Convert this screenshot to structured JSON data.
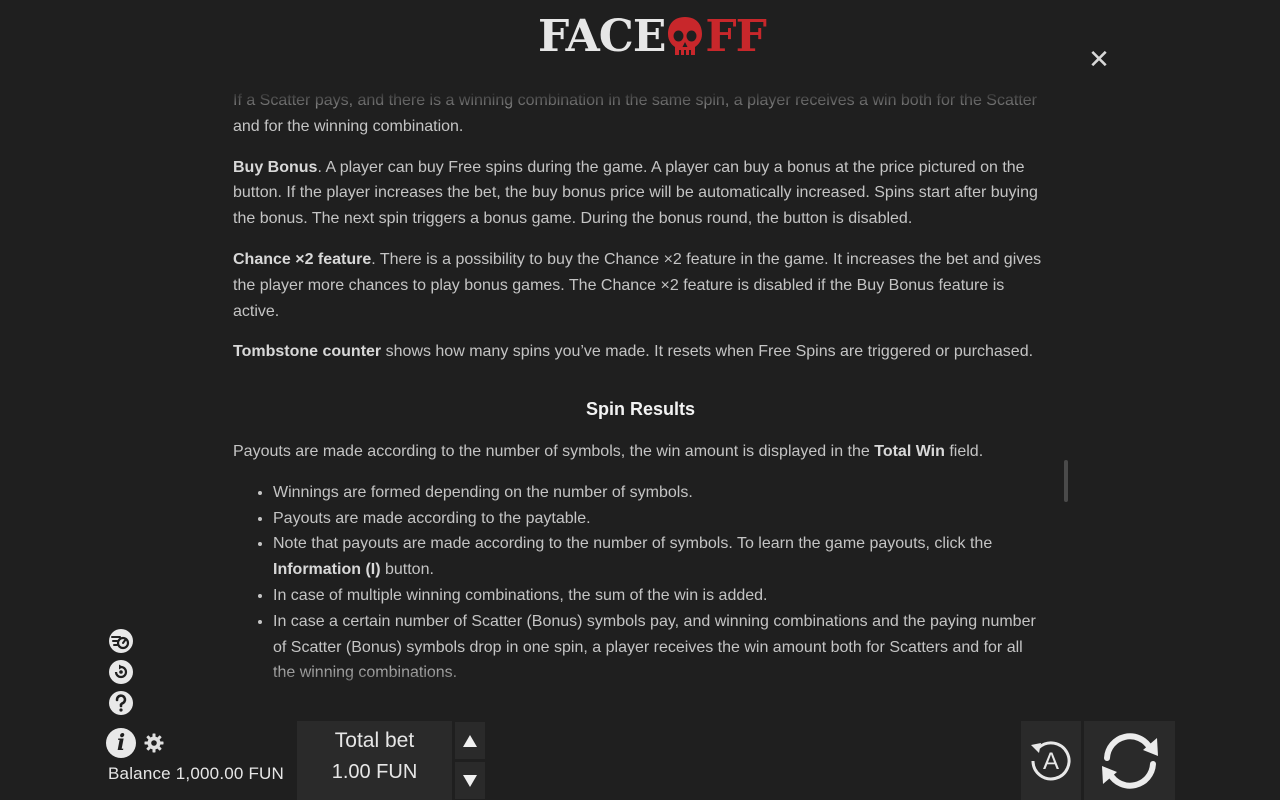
{
  "header": {
    "logo_left": "FACE",
    "logo_right": "FF",
    "close_symbol": "✕"
  },
  "rules": {
    "intro_partial": "If a Scatter pays, and there is a winning combination in the same spin, a player receives a win both for the Scatter and for the winning combination.",
    "buy_bonus_title": "Buy Bonus",
    "buy_bonus_text": ". A player can buy Free spins during the game. A player can buy a bonus at the price pictured on the button. If the player increases the bet, the buy bonus price will be automatically increased. Spins start after buying the bonus. The next spin triggers a bonus game. During the bonus round, the button is disabled.",
    "chance_title": "Chance ×2 feature",
    "chance_text": ". There is a possibility to buy the Chance ×2 feature in the game. It increases the bet and gives the player more chances to play bonus games. The Chance ×2 feature is disabled if the Buy Bonus feature is active.",
    "tombstone_title": "Tombstone counter",
    "tombstone_text": " shows how many spins you’ve made. It resets when Free Spins are triggered or purchased.",
    "spin_results_heading": "Spin Results",
    "payouts_text_before": "Payouts are made according to the number of symbols, the win amount is displayed in the ",
    "payouts_bold": "Total Win",
    "payouts_text_after": " field.",
    "bullet_1": "Winnings are formed depending on the number of symbols.",
    "bullet_2": "Payouts are made according to the paytable.",
    "bullet_3_before": "Note that payouts are made according to the number of symbols. To learn the game payouts, click the ",
    "bullet_3_bold": "Information (I)",
    "bullet_3_after": " button.",
    "bullet_4": "In case of multiple winning combinations, the sum of the win is added.",
    "bullet_5": "In case a certain number of Scatter (Bonus) symbols pay, and winning combinations and the paying number of Scatter (Bonus) symbols drop in one spin, a player receives the win amount both for Scatters and for all the winning combinations."
  },
  "footer": {
    "info_symbol": "i",
    "balance_label": "Balance",
    "balance_value": "1,000.00 FUN",
    "total_bet_label": "Total bet",
    "total_bet_value": "1.00 FUN",
    "auto_letter": "A"
  },
  "icons": {
    "turbo": "turbo-icon",
    "autoplay_settings": "quick-spin-icon",
    "help": "help-icon",
    "info": "info-icon",
    "settings": "gear-icon",
    "bet_up": "triangle-up-icon",
    "bet_down": "triangle-down-icon",
    "auto": "autoplay-icon",
    "spin": "spin-icon",
    "close": "close-icon"
  },
  "colors": {
    "background": "#1f1f1f",
    "logo_red": "#c8272b",
    "text": "#c4c4c4",
    "panel": "#2a2a2a"
  }
}
